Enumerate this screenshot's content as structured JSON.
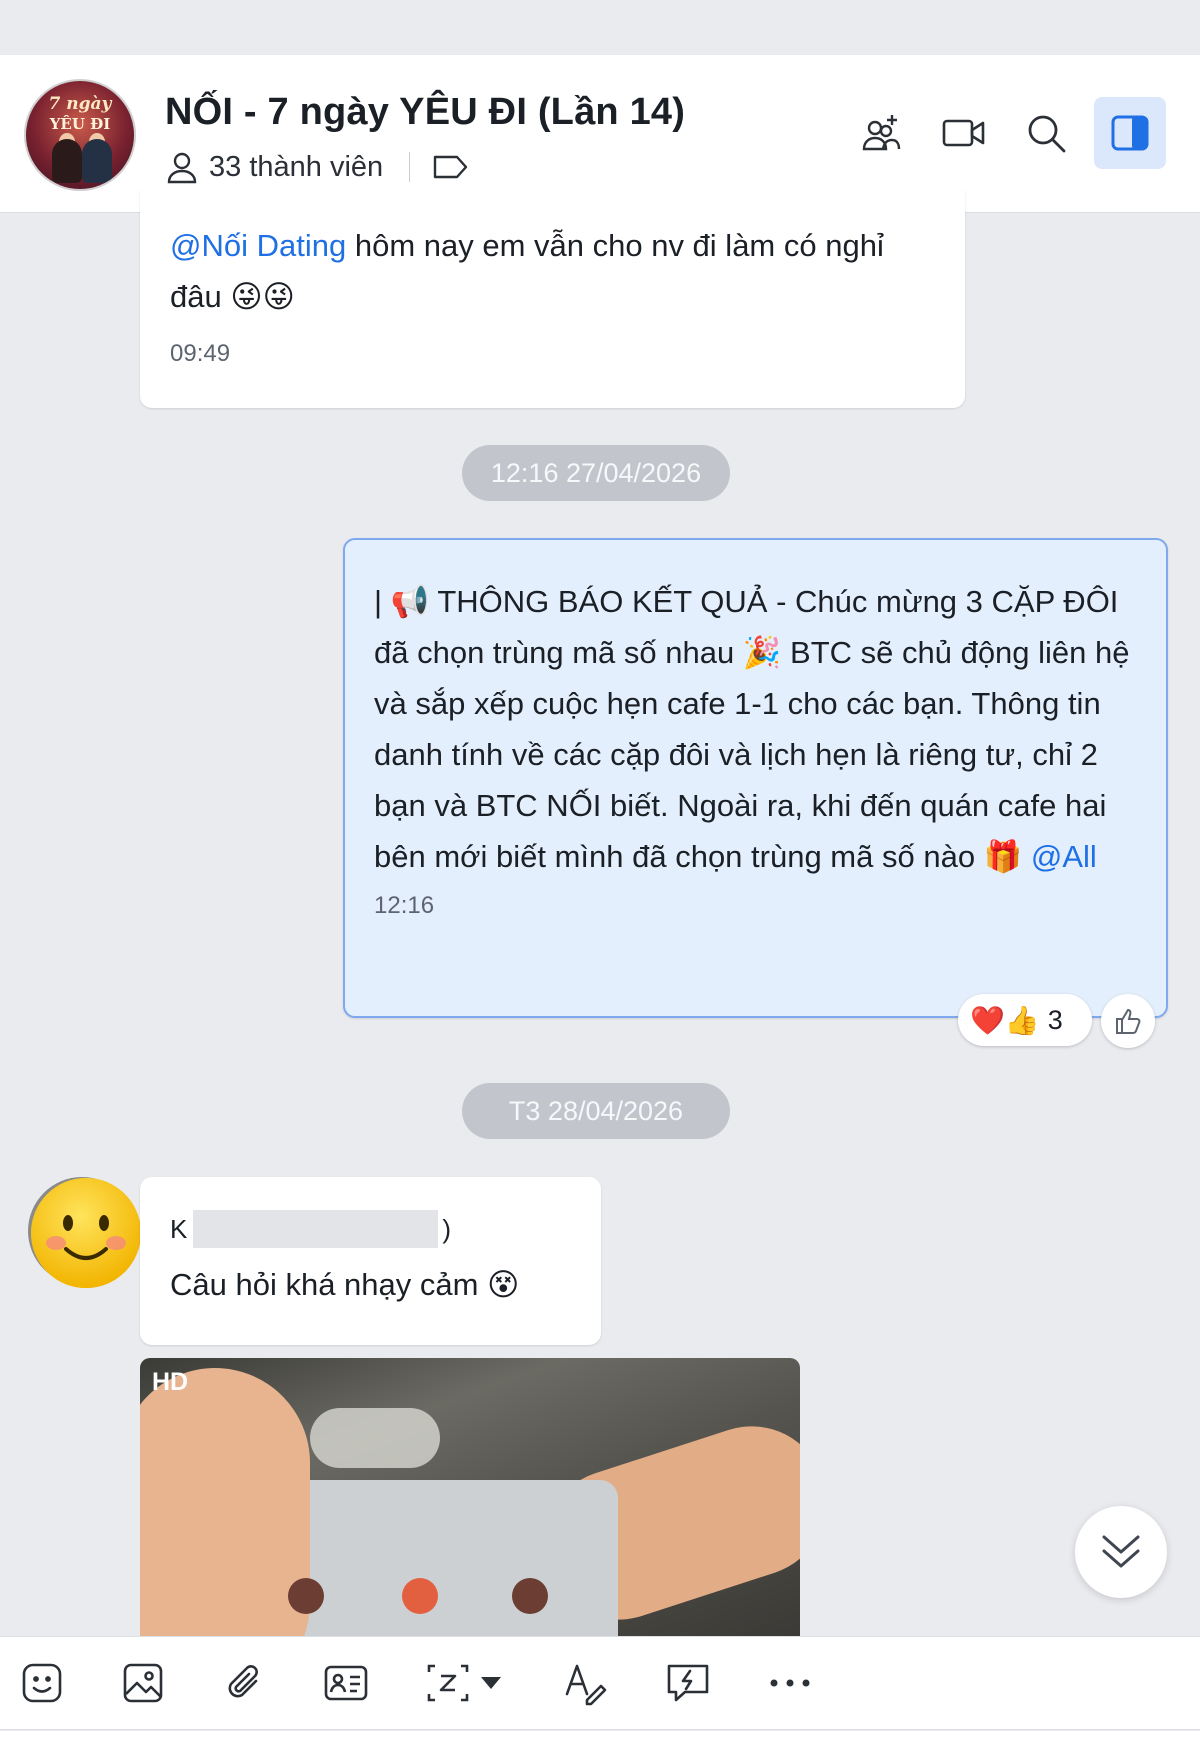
{
  "header": {
    "title": "NỐI - 7 ngày YÊU ĐI (Lần 14)",
    "member_count": "33 thành viên",
    "avatar_text_line1": "7 ngày",
    "avatar_text_line2": "YÊU ĐI",
    "icons": [
      "add-member-icon",
      "video-call-icon",
      "search-icon",
      "side-panel-icon"
    ]
  },
  "messages": [
    {
      "mention": "@Nối Dating",
      "text": " hôm nay em vẫn cho nv đi làm có nghỉ đâu 😜😜",
      "time": "09:49"
    },
    {
      "date_separator": "12:16 27/04/2026",
      "text": "| 📢 THÔNG BÁO KẾT QUẢ - Chúc mừng 3 CẶP ĐÔI đã chọn trùng mã số nhau 🎉  BTC sẽ chủ động liên hệ và sắp xếp cuộc hẹn cafe 1-1 cho các bạn. Thông tin danh tính về các cặp đôi và lịch hẹn là riêng tư, chỉ 2 bạn và BTC NỐI biết. Ngoài ra, khi đến quán cafe hai bên mới biết mình đã chọn trùng mã số nào 🎁 ",
      "mention": "@All",
      "time": "12:16",
      "reactions": {
        "emojis": "❤️👍",
        "count": "3"
      }
    },
    {
      "date_separator": "T3 28/04/2026",
      "sender_prefix": "K",
      "sender_suffix": ")",
      "text": "Câu hỏi khá nhạy cảm 😵",
      "photo_badge": "HD"
    }
  ],
  "toolbar": {
    "icons": [
      "sticker-icon",
      "image-icon",
      "attach-icon",
      "contact-card-icon",
      "screenshot-icon",
      "format-text-icon",
      "quick-message-icon",
      "more-icon"
    ]
  },
  "colors": {
    "accent": "#1f6fe5",
    "own_bubble": "#e4effd",
    "own_bubble_border": "#7fa9ee",
    "background": "#e9ebef"
  }
}
